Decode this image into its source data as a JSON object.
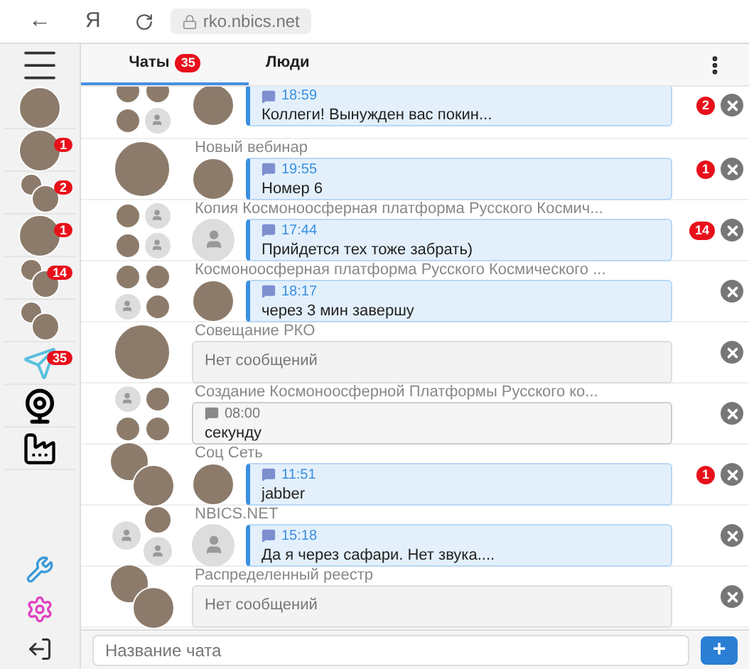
{
  "browser": {
    "back": "←",
    "yandex": "Я",
    "url": "rko.nbics.net"
  },
  "sidebar": {
    "items": [
      {
        "kind": "avatar"
      },
      {
        "kind": "avatar",
        "badge": "1"
      },
      {
        "kind": "group",
        "badge": "2"
      },
      {
        "kind": "avatar",
        "badge": "1"
      },
      {
        "kind": "group",
        "badge": "14"
      },
      {
        "kind": "group"
      },
      {
        "kind": "send",
        "badge": "35"
      },
      {
        "kind": "webcam"
      },
      {
        "kind": "factory"
      }
    ],
    "bottom": [
      {
        "kind": "tools"
      },
      {
        "kind": "settings"
      }
    ]
  },
  "tabs": [
    {
      "label": "Чаты",
      "badge": "35",
      "selected": true
    },
    {
      "label": "Люди",
      "selected": false
    }
  ],
  "chats": [
    {
      "avatars": [
        {
          "kind": "photo"
        },
        {
          "kind": "photo"
        },
        {
          "kind": "photo"
        },
        {
          "kind": "placeholder"
        }
      ],
      "sender": {
        "kind": "photo"
      },
      "message": {
        "kind": "incoming",
        "time": "18:59",
        "text": "Коллеги! Вынужден вас покин..."
      },
      "unread": "2"
    },
    {
      "title": "Новый вебинар",
      "avatars": [
        {
          "kind": "photo"
        }
      ],
      "sender": {
        "kind": "photo"
      },
      "message": {
        "kind": "incoming",
        "time": "19:55",
        "text": "Номер 6"
      },
      "unread": "1"
    },
    {
      "title": "Копия Космоноосферная платформа Русского Космич...",
      "avatars": [
        {
          "kind": "photo"
        },
        {
          "kind": "placeholder"
        },
        {
          "kind": "photo"
        },
        {
          "kind": "placeholder"
        }
      ],
      "sender": {
        "kind": "placeholder"
      },
      "message": {
        "kind": "incoming",
        "time": "17:44",
        "text": "Прийдется тех тоже забрать)"
      },
      "unread": "14"
    },
    {
      "title": "Космоноосферная платформа Русского Космического ...",
      "avatars": [
        {
          "kind": "photo"
        },
        {
          "kind": "photo"
        },
        {
          "kind": "placeholder"
        },
        {
          "kind": "photo"
        }
      ],
      "sender": {
        "kind": "photo"
      },
      "message": {
        "kind": "incoming",
        "time": "18:17",
        "text": "через 3 мин завершу"
      }
    },
    {
      "title": "Совещание РКО",
      "avatars": [
        {
          "kind": "photo"
        }
      ],
      "message": {
        "kind": "empty",
        "text": "Нет сообщений"
      }
    },
    {
      "title": "Создание Космоноосферной Платформы Русского ко...",
      "avatars": [
        {
          "kind": "placeholder"
        },
        {
          "kind": "photo"
        },
        {
          "kind": "photo"
        },
        {
          "kind": "photo"
        }
      ],
      "message": {
        "kind": "own",
        "time": "08:00",
        "text": "секунду"
      }
    },
    {
      "title": "Соц Сеть",
      "avatars": [
        {
          "kind": "photo"
        },
        {
          "kind": "photo"
        }
      ],
      "sender": {
        "kind": "photo"
      },
      "message": {
        "kind": "incoming",
        "time": "11:51",
        "text": "jabber"
      },
      "unread": "1"
    },
    {
      "title": "NBICS.NET",
      "avatars": [
        {
          "kind": "placeholder"
        },
        {
          "kind": "photo"
        },
        {
          "kind": "placeholder"
        }
      ],
      "sender": {
        "kind": "placeholder"
      },
      "message": {
        "kind": "incoming",
        "time": "15:18",
        "text": "Да я через сафари. Нет звука...."
      }
    },
    {
      "title": "Распределенный реестр",
      "avatars": [
        {
          "kind": "photo"
        },
        {
          "kind": "photo"
        }
      ],
      "message": {
        "kind": "empty",
        "text": "Нет сообщений"
      }
    }
  ],
  "footer": {
    "placeholder": "Название чата",
    "add": "+"
  }
}
